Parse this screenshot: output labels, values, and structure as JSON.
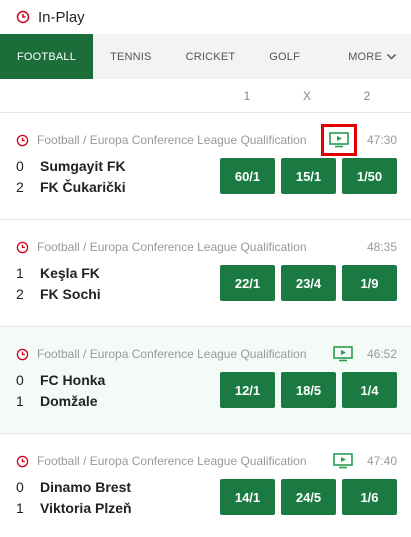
{
  "header": {
    "title": "In-Play"
  },
  "tabs": [
    {
      "label": "FOOTBALL",
      "active": true
    },
    {
      "label": "TENNIS",
      "active": false
    },
    {
      "label": "CRICKET",
      "active": false
    },
    {
      "label": "GOLF",
      "active": false
    }
  ],
  "more_label": "MORE",
  "columns": [
    "1",
    "X",
    "2"
  ],
  "colors": {
    "brand_green": "#1b6e3a",
    "odds_green": "#1b7a42",
    "highlight_red": "#e10000"
  },
  "matches": [
    {
      "league": "Football / Europa Conference League Qualification",
      "time": "47:30",
      "tv": true,
      "tv_highlighted": true,
      "team1": {
        "score": "0",
        "name": "Sumgayit FK"
      },
      "team2": {
        "score": "2",
        "name": "FK Čukarički"
      },
      "odds": [
        "60/1",
        "15/1",
        "1/50"
      ]
    },
    {
      "league": "Football / Europa Conference League Qualification",
      "time": "48:35",
      "tv": false,
      "tv_highlighted": false,
      "team1": {
        "score": "1",
        "name": "Keşla FK"
      },
      "team2": {
        "score": "2",
        "name": "FK Sochi"
      },
      "odds": [
        "22/1",
        "23/4",
        "1/9"
      ]
    },
    {
      "league": "Football / Europa Conference League Qualification",
      "time": "46:52",
      "tv": true,
      "tv_highlighted": false,
      "team1": {
        "score": "0",
        "name": "FC Honka"
      },
      "team2": {
        "score": "1",
        "name": "Domžale"
      },
      "odds": [
        "12/1",
        "18/5",
        "1/4"
      ]
    },
    {
      "league": "Football / Europa Conference League Qualification",
      "time": "47:40",
      "tv": true,
      "tv_highlighted": false,
      "team1": {
        "score": "0",
        "name": "Dinamo Brest"
      },
      "team2": {
        "score": "1",
        "name": "Viktoria Plzeň"
      },
      "odds": [
        "14/1",
        "24/5",
        "1/6"
      ]
    }
  ]
}
